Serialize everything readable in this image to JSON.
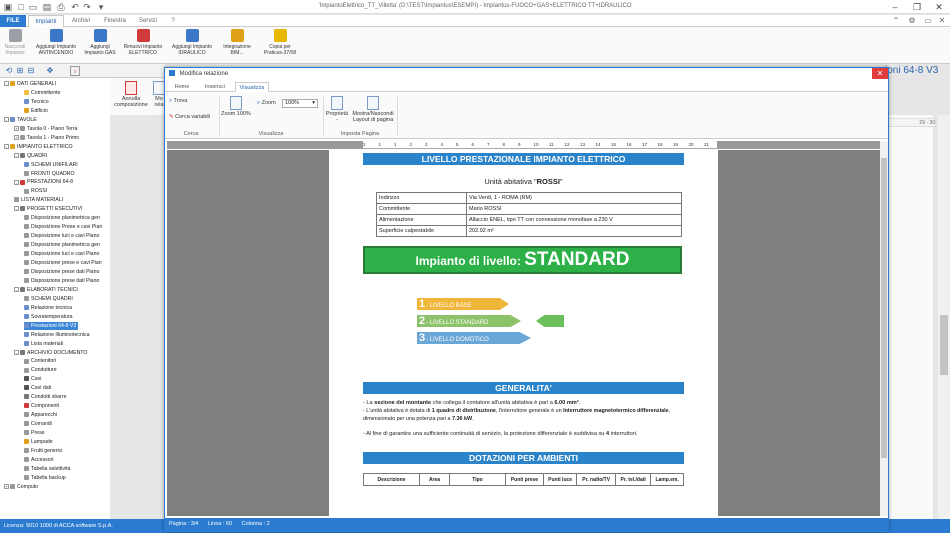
{
  "window": {
    "title": "'ImpiantoElettrico_TT_Villetta' (D:\\TEST\\Impiantus\\ESEMPI) - Impiantus-FUOCO+GAS+ELETTRICO TT+IDRAULICO",
    "min": "–",
    "max": "❐",
    "close": "✕"
  },
  "menu": {
    "tabs": [
      "FILE",
      "Impianti",
      "Archivi",
      "Finestra",
      "Servizi",
      "?"
    ]
  },
  "ribbon": {
    "buttons": [
      {
        "label": "Nascondi\nImpianto",
        "color": "#9aa0a6",
        "disabled": true
      },
      {
        "label": "Aggiungi Impianto\nANTINCENDIO",
        "color": "#3c78c8"
      },
      {
        "label": "Aggiungi\nImpianto GAS",
        "color": "#3c78c8"
      },
      {
        "label": "Rimuovi Impianto\nELETTRICO",
        "color": "#d13a3a"
      },
      {
        "label": "Aggiungi Impianto\nIDRAULICO",
        "color": "#3c78c8"
      },
      {
        "label": "Integrazione\nBIM...",
        "color": "#e0a21a"
      },
      {
        "label": "Copia per\nPraticus-37/08",
        "color": "#e6b800"
      }
    ]
  },
  "background_doc": {
    "header": "zioni 64-8 V3",
    "ribbon_buttons": [
      {
        "label": "Annulla\ncomposizione"
      },
      {
        "label": "Mo\nrela"
      }
    ],
    "ruler": "29 · 30"
  },
  "tree": {
    "items": [
      {
        "label": "DATI GENERALI",
        "level": 0,
        "box": "-",
        "color": "#e0a21a"
      },
      {
        "label": "Committente",
        "level": 2,
        "color": "#f0c040"
      },
      {
        "label": "Tecnico",
        "level": 2,
        "color": "#6c8fc8"
      },
      {
        "label": "Edificio",
        "level": 2,
        "color": "#e0a21a"
      },
      {
        "label": "TAVOLE",
        "level": 0,
        "box": "-",
        "color": "#6c8fc8"
      },
      {
        "label": "Tavola 0 - Piano Terra",
        "level": 1,
        "box": "+",
        "color": "#999"
      },
      {
        "label": "Tavola 1 - Piano Primo",
        "level": 1,
        "box": "+",
        "color": "#999"
      },
      {
        "label": "IMPIANTO ELETTRICO",
        "level": 0,
        "box": "-",
        "color": "#e0a21a"
      },
      {
        "label": "QUADRI",
        "level": 1,
        "box": "-",
        "color": "#777"
      },
      {
        "label": "SCHEMI UNIFILARI",
        "level": 2,
        "color": "#6c8fc8"
      },
      {
        "label": "FRONTI QUADRO",
        "level": 2,
        "color": "#999"
      },
      {
        "label": "PRESTAZIONI 64-8",
        "level": 1,
        "box": "-",
        "color": "#d13a3a"
      },
      {
        "label": "ROSSI",
        "level": 2,
        "color": "#999"
      },
      {
        "label": "LISTA MATERIALI",
        "level": 1,
        "color": "#999"
      },
      {
        "label": "PROGETTI ESECUTIVI",
        "level": 1,
        "box": "-",
        "color": "#777"
      },
      {
        "label": "Disposizione planimetrica gen",
        "level": 2,
        "color": "#999"
      },
      {
        "label": "Disposizione Prese e cavi Pian",
        "level": 2,
        "color": "#999"
      },
      {
        "label": "Disposizione luci e cavi Piano",
        "level": 2,
        "color": "#999"
      },
      {
        "label": "Disposizione planimetrica gen",
        "level": 2,
        "color": "#999"
      },
      {
        "label": "Disposizione luci e cavi Piano",
        "level": 2,
        "color": "#999"
      },
      {
        "label": "Disposizione prese e cavi Pian",
        "level": 2,
        "color": "#999"
      },
      {
        "label": "Disposizione prese dati Piano",
        "level": 2,
        "color": "#999"
      },
      {
        "label": "Disposizione prese dati Piano",
        "level": 2,
        "color": "#999"
      },
      {
        "label": "ELABORATI TECNICI",
        "level": 1,
        "box": "-",
        "color": "#777"
      },
      {
        "label": "SCHEMI QUADRI",
        "level": 2,
        "color": "#999"
      },
      {
        "label": "Relazione tecnica",
        "level": 2,
        "color": "#6c8fc8"
      },
      {
        "label": "Sovratemperatura",
        "level": 2,
        "color": "#6c8fc8"
      },
      {
        "label": "Prestazioni 64-8 V3",
        "level": 2,
        "color": "#6c8fc8",
        "selected": true
      },
      {
        "label": "Relazione illuminotecnica",
        "level": 2,
        "color": "#6c8fc8"
      },
      {
        "label": "Lista materiali",
        "level": 2,
        "color": "#6c8fc8"
      },
      {
        "label": "ARCHIVIO DOCUMENTO",
        "level": 1,
        "box": "-",
        "color": "#777"
      },
      {
        "label": "Contenitori",
        "level": 2,
        "color": "#999"
      },
      {
        "label": "Condutture",
        "level": 2,
        "color": "#999"
      },
      {
        "label": "Cavi",
        "level": 2,
        "color": "#555"
      },
      {
        "label": "Cavi dati",
        "level": 2,
        "color": "#555"
      },
      {
        "label": "Condotti sbarre",
        "level": 2,
        "color": "#777"
      },
      {
        "label": "Componenti",
        "level": 2,
        "color": "#d13a3a"
      },
      {
        "label": "Apparecchi",
        "level": 2,
        "color": "#999"
      },
      {
        "label": "Comandi",
        "level": 2,
        "color": "#999"
      },
      {
        "label": "Prese",
        "level": 2,
        "color": "#999"
      },
      {
        "label": "Lampade",
        "level": 2,
        "color": "#e0a21a"
      },
      {
        "label": "Frutti generici",
        "level": 2,
        "color": "#999"
      },
      {
        "label": "Accessori",
        "level": 2,
        "color": "#999"
      },
      {
        "label": "Tabella selettività",
        "level": 2,
        "color": "#999"
      },
      {
        "label": "Tabella backup",
        "level": 2,
        "color": "#999"
      },
      {
        "label": "Computo",
        "level": 0,
        "box": "+",
        "color": "#999"
      }
    ]
  },
  "statusbar": {
    "text": "Licenza: 9010 1000 di ACCA software S.p.A."
  },
  "dialog": {
    "title": "Modifica relazione",
    "close": "✕",
    "tabs": [
      "Home",
      "Inserisci",
      "Visualizza"
    ],
    "ribbon": {
      "trova": "Trova",
      "cerca_variabili": "Cerca variabili",
      "zoom_label": "Zoom",
      "zoom_value": "100%",
      "zoom100": "Zoom 100%",
      "proprieta": "Proprietà\n-",
      "mostra_layout": "Mostra/Nascondi\nLayout di pagina",
      "groups": [
        "Cerca",
        "Visualizza",
        "Imposta Pagina"
      ]
    },
    "ruler_ticks": [
      "2",
      "1",
      "1",
      "2",
      "3",
      "4",
      "5",
      "6",
      "7",
      "8",
      "9",
      "10",
      "11",
      "12",
      "13",
      "14",
      "15",
      "16",
      "17",
      "18",
      "19",
      "20",
      "21"
    ],
    "status": {
      "pagina": "Pagina : 3/4",
      "linea": "Linea : 60",
      "colonna": "Colonna : 2"
    }
  },
  "document": {
    "heading": "LIVELLO PRESTAZIONALE IMPIANTO ELETTRICO",
    "unit_prefix": "Unità abitativa \"",
    "unit_name": "ROSSI",
    "unit_suffix": "\"",
    "info": [
      {
        "k": "Indirizzo",
        "v": "Via Verdi, 1 - ROMA (RM)"
      },
      {
        "k": "Committente",
        "v": "Mario ROSSI"
      },
      {
        "k": "Alimentazione",
        "v": "Allaccio ENEL, tipo TT con connessione monofase a 230 V"
      },
      {
        "k": "Superficie calpestabile",
        "v": "202.92 m²"
      }
    ],
    "level_prefix": "Impianto di livello: ",
    "level_value": "STANDARD",
    "levels": [
      {
        "num": "1",
        "label": "- LIVELLO BASE",
        "color": "#f0b63a"
      },
      {
        "num": "2",
        "label": "- LIVELLO STANDARD",
        "color": "#8cc36a"
      },
      {
        "num": "3",
        "label": "- LIVELLO DOMOTICO",
        "color": "#6aa6d6"
      }
    ],
    "generalita_title": "GENERALITA'",
    "generalita": [
      {
        "pre": "La ",
        "b1": "sezione del montante",
        "mid": " che collega il contatore all'unità abitativa è pari a ",
        "b2": "6.00 mm²",
        "post": "."
      },
      {
        "pre": "L'unità abitativa è dotata di ",
        "b1": "1 quadro di distribuzione",
        "mid": ", l'interruttore generale è un ",
        "b2": "Interruttore magnetotermico differenziale",
        "post": ", dimensionato per una potenza pari a ",
        "b3": "7.36 kW",
        "end": "."
      },
      {
        "pre": "Al fine di garantire una sufficiente continuità di servizio, la protezione differenziale è suddivisa su ",
        "b1": "4",
        "post": " interruttori."
      }
    ],
    "dotazioni_title": "DOTAZIONI PER AMBIENTI",
    "dotazioni_headers": [
      "Descrizione",
      "Area",
      "Tipo",
      "Punti prese",
      "Punti luce",
      "Pr. radio/TV",
      "Pr. tel./dati",
      "Lamp.em."
    ]
  }
}
